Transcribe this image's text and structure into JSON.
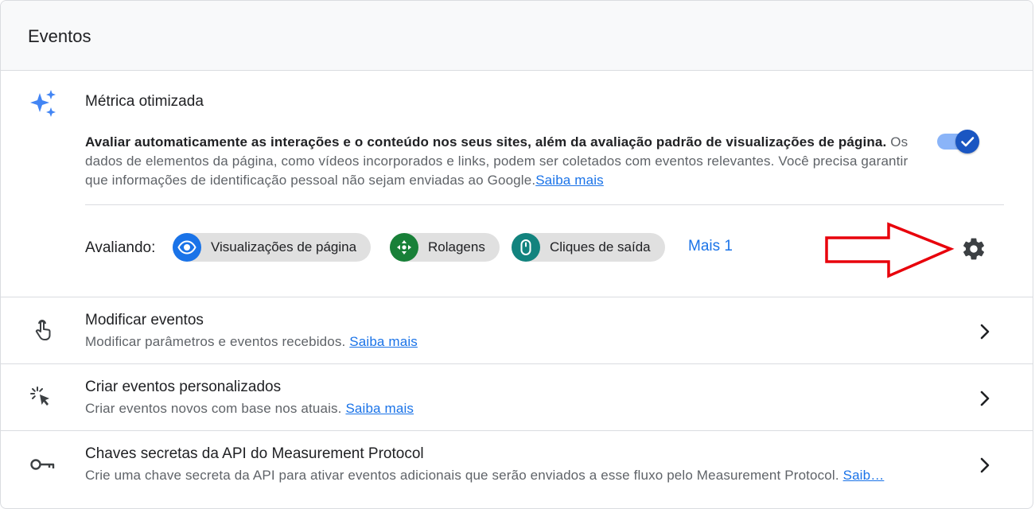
{
  "header": {
    "title": "Eventos"
  },
  "enhanced": {
    "title": "Métrica otimizada",
    "desc_bold": "Avaliar automaticamente as interações e o conteúdo nos seus sites, além da avaliação padrão de visualizações de página.",
    "desc_rest": "Os dados de elementos da página, como vídeos incorporados e links, podem ser coletados com eventos relevantes. Você precisa garantir que informações de identificação pessoal não sejam enviadas ao Google.",
    "learn_more": "Saiba mais",
    "toggle_on": true,
    "measuring_label": "Avaliando:",
    "chips": [
      {
        "label": "Visualizações de página",
        "icon": "eye-icon",
        "color": "#1a73e8"
      },
      {
        "label": "Rolagens",
        "icon": "scroll-icon",
        "color": "#188038"
      },
      {
        "label": "Cliques de saída",
        "icon": "mouse-icon",
        "color": "#12837e"
      }
    ],
    "more_label": "Mais 1"
  },
  "rows": [
    {
      "title": "Modificar eventos",
      "subtitle": "Modificar parâmetros e eventos recebidos.",
      "link": "Saiba mais",
      "icon": "touch-icon"
    },
    {
      "title": "Criar eventos personalizados",
      "subtitle": "Criar eventos novos com base nos atuais.",
      "link": "Saiba mais",
      "icon": "cursor-click-icon"
    },
    {
      "title": "Chaves secretas da API do Measurement Protocol",
      "subtitle": "Crie uma chave secreta da API para ativar eventos adicionais que serão enviados a esse fluxo pelo Measurement Protocol.",
      "link": "Saib…",
      "icon": "key-icon"
    }
  ],
  "colors": {
    "accent": "#1a73e8",
    "annotation_arrow": "#e8000b"
  }
}
